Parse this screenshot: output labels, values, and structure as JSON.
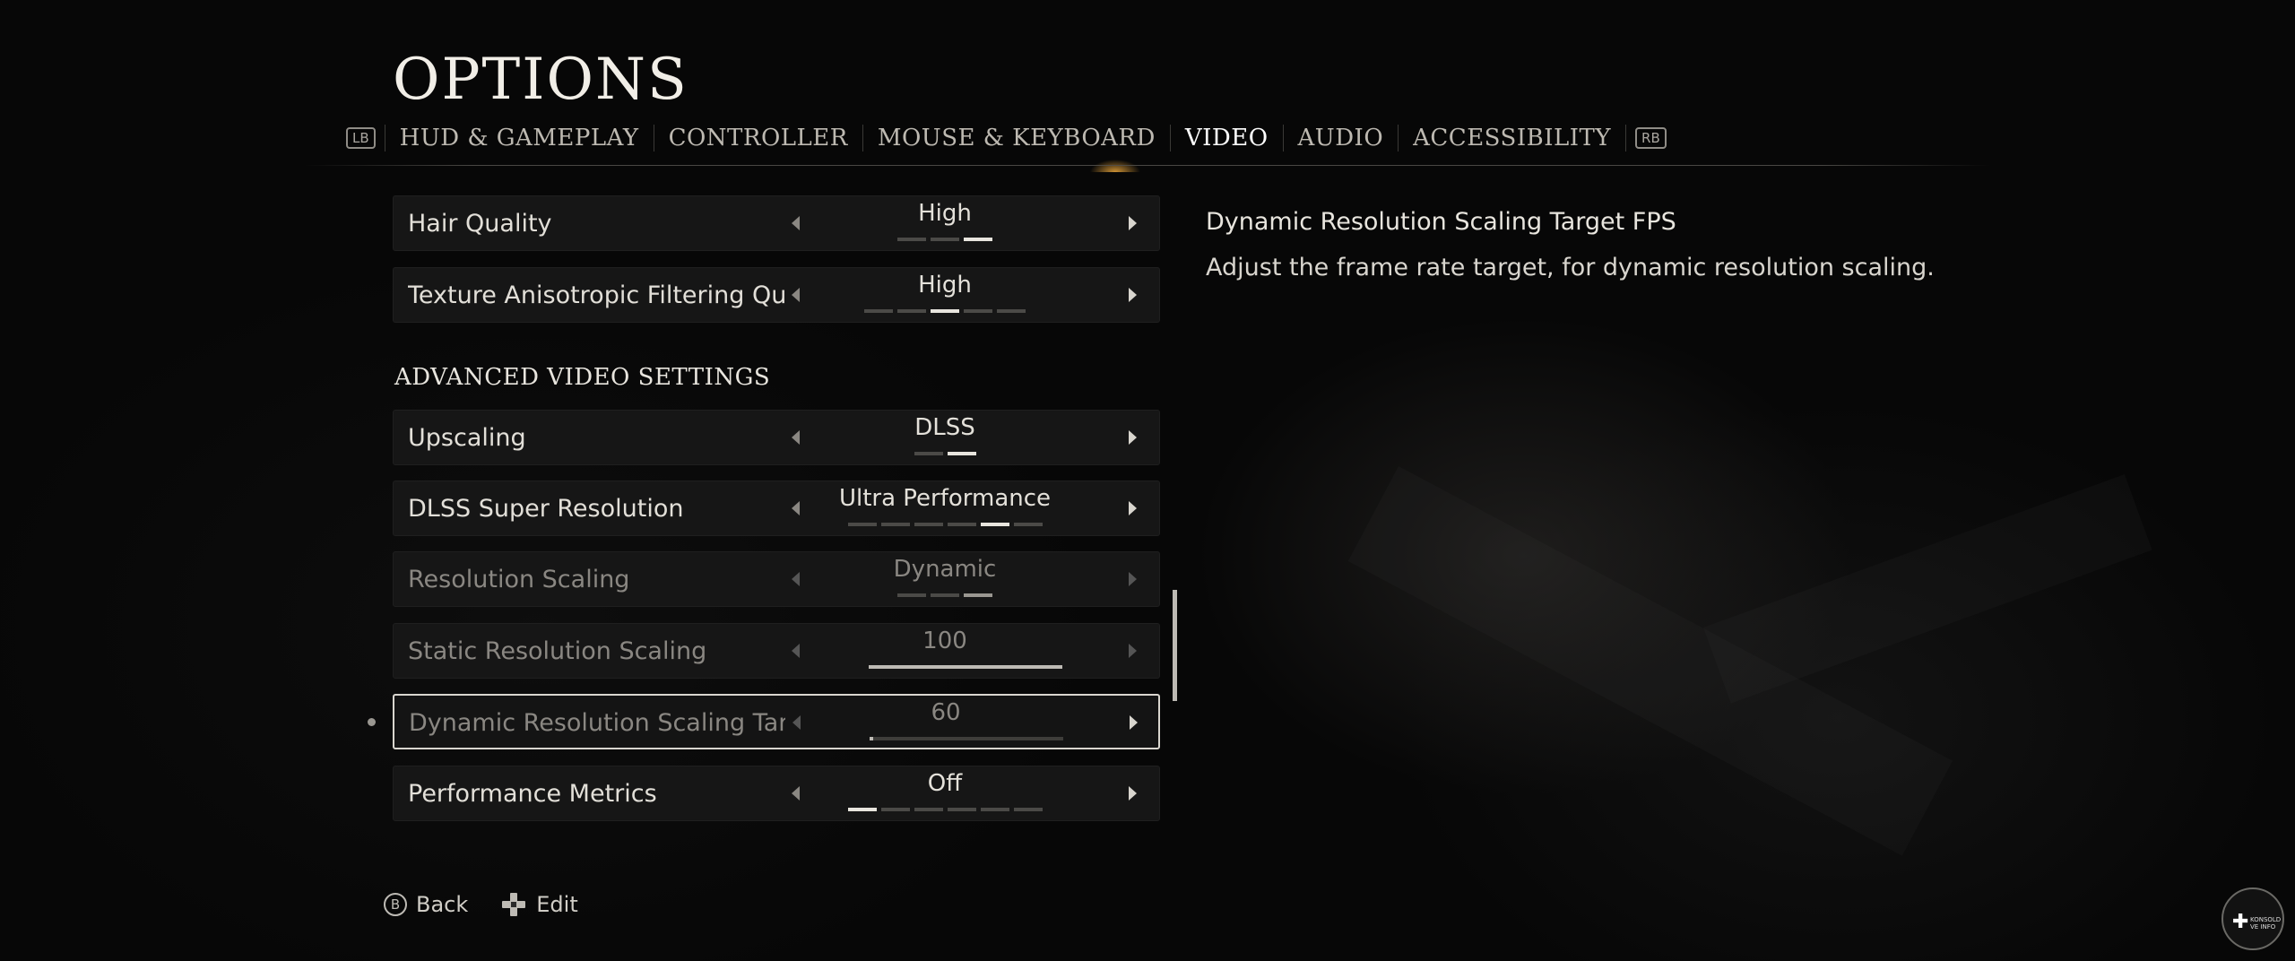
{
  "page": {
    "title": "OPTIONS"
  },
  "tabs": {
    "left_bumper": "LB",
    "right_bumper": "RB",
    "items": [
      {
        "label": "HUD & GAMEPLAY"
      },
      {
        "label": "CONTROLLER"
      },
      {
        "label": "MOUSE & KEYBOARD"
      },
      {
        "label": "VIDEO",
        "active": true
      },
      {
        "label": "AUDIO"
      },
      {
        "label": "ACCESSIBILITY"
      }
    ]
  },
  "settings": {
    "hair_quality": {
      "label": "Hair Quality",
      "value": "High",
      "steps": 3,
      "selected": 3
    },
    "texture_aniso": {
      "label": "Texture Anisotropic Filtering Quali",
      "value": "High",
      "steps": 5,
      "selected": 3
    },
    "section_title": "ADVANCED VIDEO SETTINGS",
    "upscaling": {
      "label": "Upscaling",
      "value": "DLSS",
      "steps": 2,
      "selected": 2
    },
    "dlss": {
      "label": "DLSS Super Resolution",
      "value": "Ultra Performance",
      "steps": 6,
      "selected": 5
    },
    "resolution_scaling": {
      "label": "Resolution Scaling",
      "value": "Dynamic",
      "steps": 3,
      "selected": 3,
      "disabled": true
    },
    "static_res": {
      "label": "Static Resolution Scaling",
      "value": "100",
      "slider_fraction": 1.0,
      "disabled": true
    },
    "dynamic_res": {
      "label": "Dynamic Resolution Scaling Targe",
      "value": "60",
      "slider_fraction": 0.02,
      "disabled": true,
      "focused": true
    },
    "perf_metrics": {
      "label": "Performance Metrics",
      "value": "Off",
      "steps": 6,
      "selected": 1
    }
  },
  "description": {
    "title": "Dynamic Resolution Scaling Target FPS",
    "text": "Adjust the frame rate target, for dynamic resolution scaling."
  },
  "hints": {
    "back_button": "B",
    "back_label": "Back",
    "edit_label": "Edit"
  },
  "badge": {
    "text": "KONSOLD VE INFO"
  }
}
